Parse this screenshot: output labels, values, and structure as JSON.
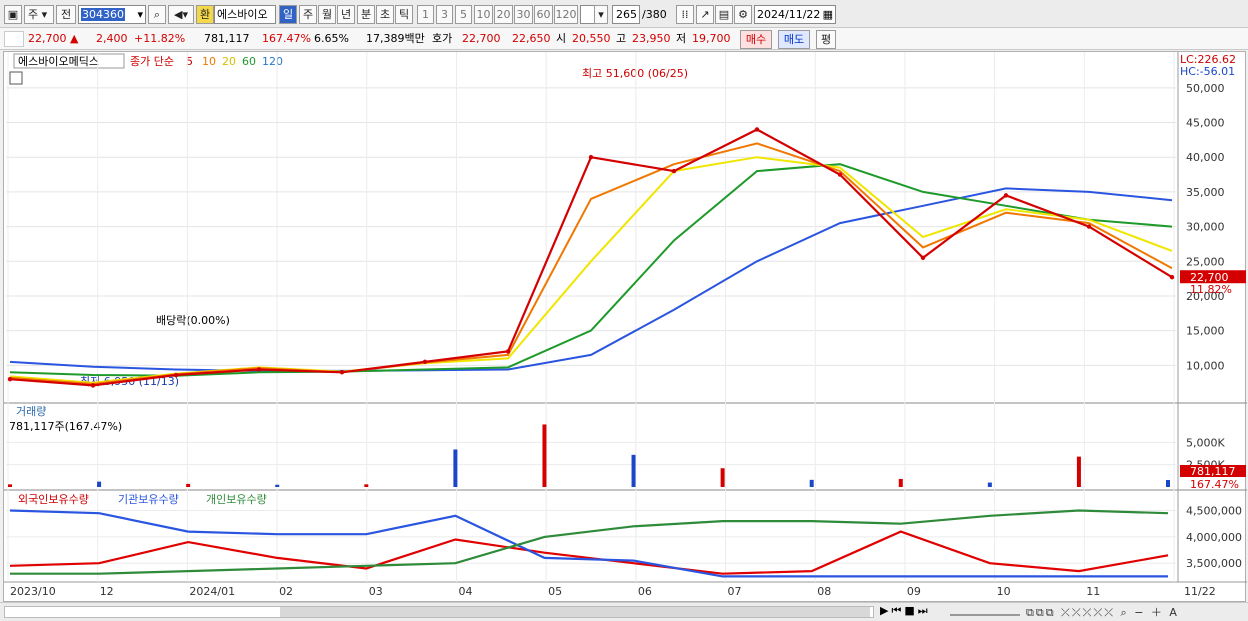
{
  "toolbar": {
    "market_label": "주",
    "prev_label": "전",
    "code": "304360",
    "han_label": "환",
    "stock_name": "에스바이오",
    "periods": [
      "일",
      "주",
      "월",
      "년",
      "분",
      "초",
      "틱"
    ],
    "intervals": [
      "1",
      "3",
      "5",
      "10",
      "20",
      "30",
      "60",
      "120"
    ],
    "count": "265",
    "count_total": "/380",
    "date": "2024/11/22"
  },
  "quote": {
    "price": "22,700",
    "change": "2,400",
    "change_pct": "+11.82%",
    "volume": "781,117",
    "vol_ratio": "167.47%",
    "turnover": "6.65%",
    "amount": "17,389백만",
    "hoga_label": "호가",
    "ask": "22,700",
    "bid": "22,650",
    "open_label": "시",
    "open": "20,550",
    "high_label": "고",
    "high": "23,950",
    "low_label": "저",
    "low": "19,700",
    "buy_label": "매수",
    "sell_label": "매도",
    "avg_label": "평"
  },
  "legend": {
    "name": "에스바이오메딕스",
    "ma_label": "종가 단순",
    "ma5": "5",
    "ma10": "10",
    "ma20": "20",
    "ma60": "60",
    "ma120": "120",
    "lc": "LC:226.62",
    "hc": "HC:-56.01"
  },
  "annotations": {
    "high": "최고 51,600 (06/25)",
    "low": "최저 6,950 (11/13)",
    "dividend": "배당락(0.00%)"
  },
  "colors": {
    "price_line": "#d40000",
    "ma10": "#f07800",
    "ma20": "#f0e600",
    "ma60": "#1e9a2a",
    "ma120": "#2a55e0",
    "up": "#d40000",
    "down": "#1a46c8",
    "foreign": "#e00000",
    "institution": "#2a55e0",
    "individual": "#2e8b3a"
  },
  "volume_panel": {
    "title": "거래량",
    "current": "781,117주(167.47%)",
    "ticks": [
      "5,000K",
      "2,500K"
    ],
    "last_label": "781,117",
    "last_pct": "167.47%"
  },
  "holdings_panel": {
    "titles": [
      "외국인보유수량",
      "기관보유수량",
      "개인보유수량"
    ],
    "ticks": [
      "4,500,000",
      "4,000,000",
      "3,500,000"
    ]
  },
  "price_axis": {
    "ticks": [
      "50,000",
      "45,000",
      "40,000",
      "35,000",
      "30,000",
      "25,000",
      "20,000",
      "15,000",
      "10,000"
    ],
    "last_label": "22,700",
    "last_pct": "11.82%"
  },
  "x_axis": {
    "labels": [
      "2023/10",
      "12",
      "2024/01",
      "02",
      "03",
      "04",
      "05",
      "06",
      "07",
      "08",
      "09",
      "10",
      "11",
      "11/22"
    ]
  },
  "chart_data": [
    {
      "type": "line",
      "title": "에스바이오메딕스",
      "ylim": [
        5000,
        52000
      ],
      "x": [
        "2023/10",
        "11",
        "12",
        "2024/01",
        "02",
        "03",
        "04",
        "05",
        "06",
        "07",
        "08",
        "09",
        "10",
        "11",
        "11/22"
      ],
      "series": [
        {
          "name": "종가",
          "values": [
            8000,
            7100,
            8600,
            9400,
            9000,
            10500,
            12000,
            40000,
            38000,
            44000,
            37500,
            25500,
            34500,
            30000,
            22700
          ]
        },
        {
          "name": "10",
          "values": [
            8200,
            7300,
            8700,
            9600,
            9000,
            10400,
            11500,
            34000,
            39000,
            42000,
            38000,
            27000,
            32000,
            30500,
            24000
          ]
        },
        {
          "name": "20",
          "values": [
            8400,
            7500,
            8800,
            9700,
            9100,
            10300,
            11000,
            25000,
            38000,
            40000,
            38500,
            28500,
            32500,
            31000,
            26500
          ]
        },
        {
          "name": "60",
          "values": [
            9000,
            8600,
            8500,
            9000,
            9100,
            9400,
            9700,
            15000,
            28000,
            38000,
            39000,
            35000,
            33000,
            31000,
            30000
          ]
        },
        {
          "name": "120",
          "values": [
            10500,
            9800,
            9400,
            9200,
            9200,
            9300,
            9400,
            11500,
            18000,
            25000,
            30500,
            33000,
            35500,
            35000,
            33800
          ]
        }
      ]
    },
    {
      "type": "bar",
      "title": "거래량",
      "unit": "K",
      "x": [
        "2023/10",
        "12",
        "2024/01",
        "02",
        "03",
        "04",
        "05",
        "06",
        "07",
        "08",
        "09",
        "10",
        "11",
        "11/22"
      ],
      "values": [
        300,
        600,
        350,
        250,
        300,
        4200,
        7000,
        3600,
        2100,
        800,
        900,
        500,
        3400,
        781
      ]
    },
    {
      "type": "line",
      "title": "보유수량",
      "ylim": [
        3200000,
        4700000
      ],
      "x": [
        "2023/10",
        "12",
        "2024/01",
        "02",
        "03",
        "04",
        "05",
        "06",
        "07",
        "08",
        "09",
        "10",
        "11",
        "11/22"
      ],
      "series": [
        {
          "name": "외국인보유수량",
          "values": [
            3450000,
            3500000,
            3900000,
            3600000,
            3400000,
            3950000,
            3700000,
            3500000,
            3300000,
            3350000,
            4100000,
            3500000,
            3350000,
            3650000
          ]
        },
        {
          "name": "기관보유수량",
          "values": [
            4500000,
            4450000,
            4100000,
            4050000,
            4050000,
            4400000,
            3600000,
            3550000,
            3250000,
            3250000,
            3250000,
            3250000,
            3250000,
            3250000
          ]
        },
        {
          "name": "개인보유수량",
          "values": [
            3300000,
            3300000,
            3350000,
            3400000,
            3450000,
            3500000,
            4000000,
            4200000,
            4300000,
            4300000,
            4250000,
            4400000,
            4500000,
            4450000
          ]
        }
      ]
    }
  ]
}
